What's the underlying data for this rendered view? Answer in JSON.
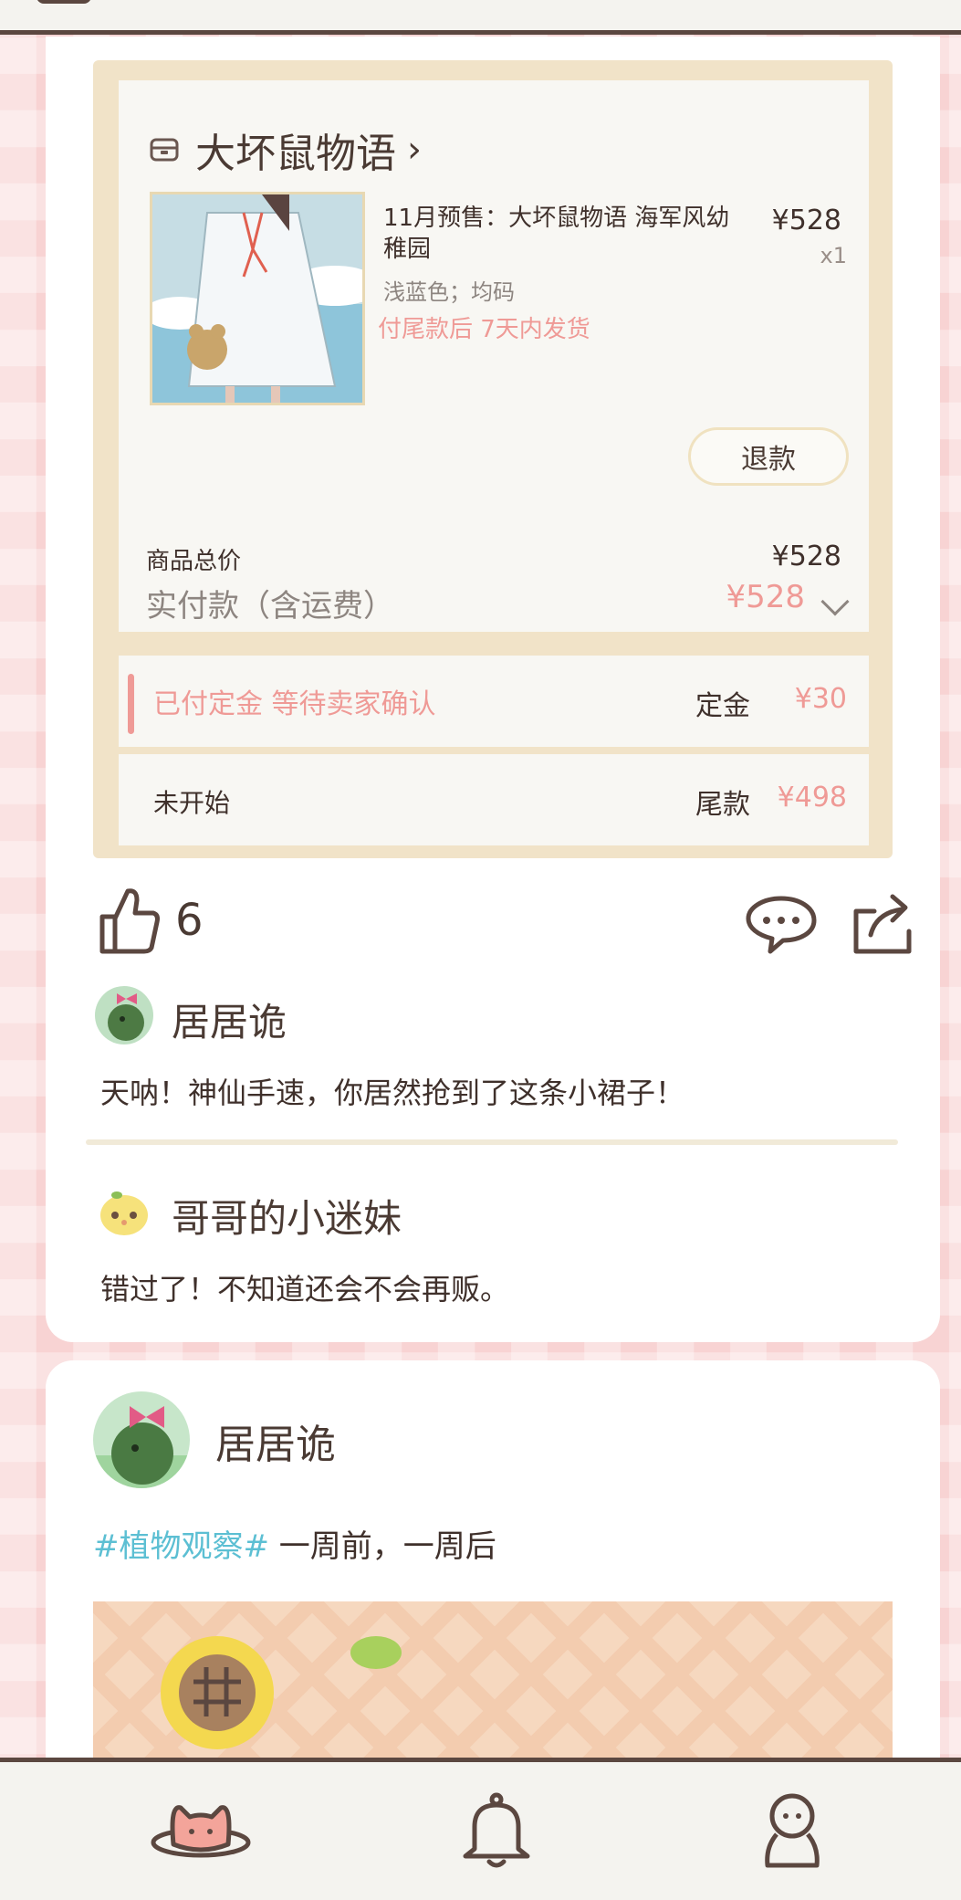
{
  "colors": {
    "accent_pink": "#ef9a96",
    "text_brown": "#4a3a33",
    "tag_blue": "#5cbfd3",
    "order_bg": "#f1e3c8",
    "background_pink": "#f8d3d3"
  },
  "order": {
    "shop_icon": "shop-icon",
    "shop_name": "大坏鼠物语",
    "shop_chevron": "›",
    "product": {
      "title": "11月预售：大坏鼠物语 海军风幼稚园",
      "price": "¥528",
      "qty": "x1",
      "spec": "浅蓝色；均码",
      "ship_note": "付尾款后 7天内发货"
    },
    "refund_label": "退款",
    "total_label": "商品总价",
    "total_value": "¥528",
    "paid_label": "实付款（含运费）",
    "paid_value": "¥528",
    "stage1": {
      "status": "已付定金  等待卖家确认",
      "key": "定金",
      "value": "¥30"
    },
    "stage2": {
      "status": "未开始",
      "key": "尾款",
      "value": "¥498"
    }
  },
  "actions": {
    "like_icon": "thumbs-up-icon",
    "like_count": "6",
    "comment_icon": "speech-bubble-icon",
    "share_icon": "share-icon"
  },
  "comments": [
    {
      "name": "居居诡",
      "text": "天呐！神仙手速，你居然抢到了这条小裙子！"
    },
    {
      "name": "哥哥的小迷妹",
      "text": "错过了！不知道还会不会再贩。"
    }
  ],
  "post2": {
    "name": "居居诡",
    "tag": "#植物观察#",
    "text": " 一周前，一周后"
  },
  "bottom_nav": {
    "items": [
      "home-cat-icon",
      "bell-icon",
      "profile-icon"
    ]
  }
}
